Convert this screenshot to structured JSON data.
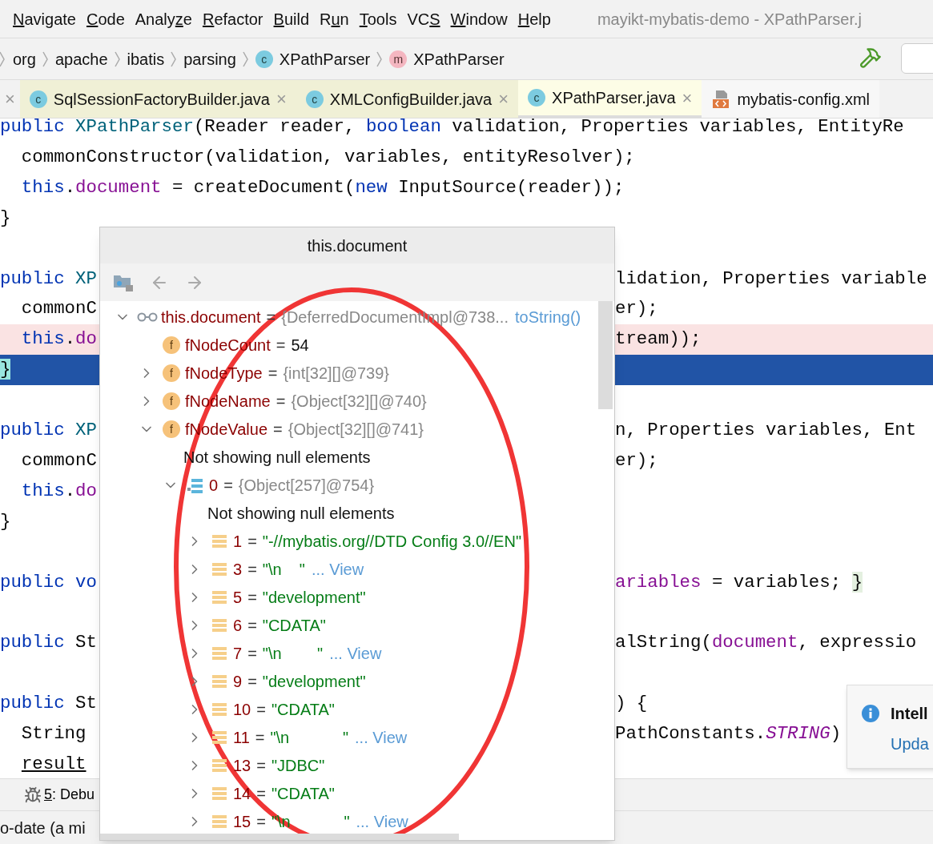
{
  "menu": [
    {
      "key": "N",
      "after": "avigate"
    },
    {
      "key": "C",
      "after": "ode"
    },
    {
      "before": "Analy",
      "key": "z",
      "after": "e"
    },
    {
      "key": "R",
      "after": "efactor"
    },
    {
      "key": "B",
      "after": "uild"
    },
    {
      "before": "R",
      "key": "u",
      "after": "n"
    },
    {
      "key": "T",
      "after": "ools"
    },
    {
      "before": "VC",
      "key": "S"
    },
    {
      "key": "W",
      "after": "indow"
    },
    {
      "key": "H",
      "after": "elp"
    }
  ],
  "window": {
    "title": "mayikt-mybatis-demo - XPathParser.j"
  },
  "breadcrumbs": [
    {
      "kind": "package",
      "label": "org"
    },
    {
      "kind": "package",
      "label": "apache"
    },
    {
      "kind": "package",
      "label": "ibatis"
    },
    {
      "kind": "package",
      "label": "parsing"
    },
    {
      "kind": "class",
      "badge": "c",
      "label": "XPathParser"
    },
    {
      "kind": "method",
      "badge": "m",
      "label": "XPathParser"
    }
  ],
  "tabs": [
    {
      "kind": "java",
      "badge": "c",
      "label": "SqlSessionFactoryBuilder.java",
      "close": "×",
      "selected": false
    },
    {
      "kind": "java",
      "badge": "c",
      "label": "XMLConfigBuilder.java",
      "close": "×",
      "selected": false
    },
    {
      "kind": "java",
      "badge": "c",
      "label": "XPathParser.java",
      "close": "×",
      "selected": true
    },
    {
      "kind": "xml",
      "label": "mybatis-config.xml",
      "selected": false
    }
  ],
  "tab_close_left": "×",
  "code": [
    {
      "kind": "normal",
      "left": [
        {
          "kind": "kw",
          "text": "public"
        },
        {
          "kind": "decl",
          "text": " XPathParser"
        },
        {
          "kind": "plain",
          "text": "(Reader reader, "
        },
        {
          "kind": "kw",
          "text": "boolean"
        },
        {
          "kind": "plain",
          "text": " validation, Properties variables, EntityRe"
        }
      ]
    },
    {
      "kind": "normal",
      "left": [
        {
          "kind": "plain",
          "text": "  commonConstructor(validation, variables, entityResolver);"
        }
      ]
    },
    {
      "kind": "normal",
      "left": [
        {
          "kind": "kw",
          "text": "  this"
        },
        {
          "kind": "plain",
          "text": "."
        },
        {
          "kind": "field",
          "text": "document"
        },
        {
          "kind": "plain",
          "text": " = createDocument("
        },
        {
          "kind": "kw",
          "text": "new"
        },
        {
          "kind": "plain",
          "text": " InputSource(reader));"
        }
      ]
    },
    {
      "kind": "normal",
      "left": [
        {
          "kind": "plain",
          "text": "}"
        }
      ]
    },
    {
      "kind": "normal"
    },
    {
      "kind": "normal",
      "left": [
        {
          "kind": "kw",
          "text": "public"
        },
        {
          "kind": "decl",
          "text": " XP"
        }
      ],
      "right": [
        {
          "kind": "plain",
          "text": "lidation, Properties variable"
        }
      ]
    },
    {
      "kind": "normal",
      "left": [
        {
          "kind": "plain",
          "text": "  commonC"
        }
      ],
      "right": [
        {
          "kind": "plain",
          "text": "er);"
        }
      ]
    },
    {
      "kind": "breakpoint",
      "left": [
        {
          "kind": "kw",
          "text": "  this"
        },
        {
          "kind": "plain",
          "text": "."
        },
        {
          "kind": "field",
          "text": "do"
        }
      ],
      "right": [
        {
          "kind": "plain",
          "text": "tream));"
        }
      ]
    },
    {
      "kind": "current",
      "left": [
        {
          "kind": "match",
          "text": "}"
        }
      ]
    },
    {
      "kind": "normal"
    },
    {
      "kind": "normal",
      "left": [
        {
          "kind": "kw",
          "text": "public"
        },
        {
          "kind": "decl",
          "text": " XP"
        }
      ],
      "right": [
        {
          "kind": "plain",
          "text": "n, Properties variables, Ent"
        }
      ]
    },
    {
      "kind": "normal",
      "left": [
        {
          "kind": "plain",
          "text": "  commonC"
        }
      ],
      "right": [
        {
          "kind": "plain",
          "text": "er);"
        }
      ]
    },
    {
      "kind": "normal",
      "left": [
        {
          "kind": "kw",
          "text": "  this"
        },
        {
          "kind": "plain",
          "text": "."
        },
        {
          "kind": "field",
          "text": "do"
        }
      ]
    },
    {
      "kind": "normal",
      "left": [
        {
          "kind": "plain",
          "text": "}"
        }
      ]
    },
    {
      "kind": "normal"
    },
    {
      "kind": "normal",
      "left": [
        {
          "kind": "kw",
          "text": "public vo"
        }
      ],
      "right": [
        {
          "kind": "field",
          "text": "ariables"
        },
        {
          "kind": "plain",
          "text": " = variables; "
        },
        {
          "kind": "fold",
          "text": "}"
        }
      ]
    },
    {
      "kind": "normal"
    },
    {
      "kind": "normal",
      "left": [
        {
          "kind": "kw",
          "text": "public"
        },
        {
          "kind": "plain",
          "text": " St"
        }
      ],
      "right": [
        {
          "kind": "plain",
          "text": "alString("
        },
        {
          "kind": "field",
          "text": "document"
        },
        {
          "kind": "plain",
          "text": ", expressio"
        }
      ]
    },
    {
      "kind": "normal"
    },
    {
      "kind": "normal",
      "left": [
        {
          "kind": "kw",
          "text": "public"
        },
        {
          "kind": "plain",
          "text": " St"
        }
      ],
      "right": [
        {
          "kind": "plain",
          "text": ") {"
        }
      ]
    },
    {
      "kind": "normal",
      "left": [
        {
          "kind": "plain",
          "text": "  String "
        }
      ],
      "right": [
        {
          "kind": "plain",
          "text": "PathConstants."
        },
        {
          "kind": "static",
          "text": "STRING"
        },
        {
          "kind": "plain",
          "text": ")"
        }
      ]
    },
    {
      "kind": "normal",
      "left": [
        {
          "kind": "under",
          "text": "result",
          "indent": true
        }
      ]
    }
  ],
  "popup": {
    "title": "this.document",
    "tree": [
      {
        "kind": "watch",
        "expanded": true,
        "name": "this.document",
        "sep": "=",
        "value": {
          "kind": "ref",
          "text": "{DeferredDocumentImpl@738..."
        },
        "link": "toString()",
        "children": [
          {
            "kind": "field",
            "badge": "f",
            "name": "fNodeCount",
            "sep": "=",
            "value": {
              "kind": "number",
              "text": "54"
            }
          },
          {
            "kind": "field",
            "badge": "f",
            "expanded": false,
            "name": "fNodeType",
            "sep": "=",
            "value": {
              "kind": "ref",
              "text": "{int[32][]@739}"
            }
          },
          {
            "kind": "field",
            "badge": "f",
            "expanded": false,
            "name": "fNodeName",
            "sep": "=",
            "value": {
              "kind": "ref",
              "text": "{Object[32][]@740}"
            }
          },
          {
            "kind": "field",
            "badge": "f",
            "expanded": true,
            "name": "fNodeValue",
            "sep": "=",
            "value": {
              "kind": "ref",
              "text": "{Object[32][]@741}"
            },
            "children": [
              {
                "kind": "note",
                "text": "Not showing null elements"
              },
              {
                "kind": "array",
                "expanded": true,
                "name": "0",
                "sep": "=",
                "value": {
                  "kind": "ref",
                  "text": "{Object[257]@754}"
                },
                "children": [
                  {
                    "kind": "note",
                    "text": "Not showing null elements"
                  },
                  {
                    "kind": "element",
                    "expanded": false,
                    "name": "1",
                    "sep": "=",
                    "value": {
                      "kind": "string",
                      "text": "\"-//mybatis.org//DTD Config 3.0//EN\""
                    }
                  },
                  {
                    "kind": "element",
                    "expanded": false,
                    "name": "3",
                    "sep": "=",
                    "value": {
                      "kind": "string",
                      "text": "\"\\n    \""
                    },
                    "link": "... View"
                  },
                  {
                    "kind": "element",
                    "expanded": false,
                    "name": "5",
                    "sep": "=",
                    "value": {
                      "kind": "string",
                      "text": "\"development\""
                    }
                  },
                  {
                    "kind": "element",
                    "expanded": false,
                    "name": "6",
                    "sep": "=",
                    "value": {
                      "kind": "string",
                      "text": "\"CDATA\""
                    }
                  },
                  {
                    "kind": "element",
                    "expanded": false,
                    "name": "7",
                    "sep": "=",
                    "value": {
                      "kind": "string",
                      "text": "\"\\n        \""
                    },
                    "link": "... View"
                  },
                  {
                    "kind": "element",
                    "expanded": false,
                    "name": "9",
                    "sep": "=",
                    "value": {
                      "kind": "string",
                      "text": "\"development\""
                    }
                  },
                  {
                    "kind": "element",
                    "expanded": false,
                    "name": "10",
                    "sep": "=",
                    "value": {
                      "kind": "string",
                      "text": "\"CDATA\""
                    }
                  },
                  {
                    "kind": "element",
                    "expanded": false,
                    "name": "11",
                    "sep": "=",
                    "value": {
                      "kind": "string",
                      "text": "\"\\n            \""
                    },
                    "link": "... View"
                  },
                  {
                    "kind": "element",
                    "expanded": false,
                    "name": "13",
                    "sep": "=",
                    "value": {
                      "kind": "string",
                      "text": "\"JDBC\""
                    }
                  },
                  {
                    "kind": "element",
                    "expanded": false,
                    "name": "14",
                    "sep": "=",
                    "value": {
                      "kind": "string",
                      "text": "\"CDATA\""
                    }
                  },
                  {
                    "kind": "element",
                    "expanded": false,
                    "name": "15",
                    "sep": "=",
                    "value": {
                      "kind": "string",
                      "text": "\"\\n            \""
                    },
                    "link": "... View"
                  }
                ]
              }
            ]
          }
        ]
      }
    ]
  },
  "tool_window": {
    "key": "5",
    "label": ": Debu"
  },
  "status_bar": {
    "text": "o-date (a mi"
  },
  "notification": {
    "title": "Intell",
    "link": "Upda"
  }
}
